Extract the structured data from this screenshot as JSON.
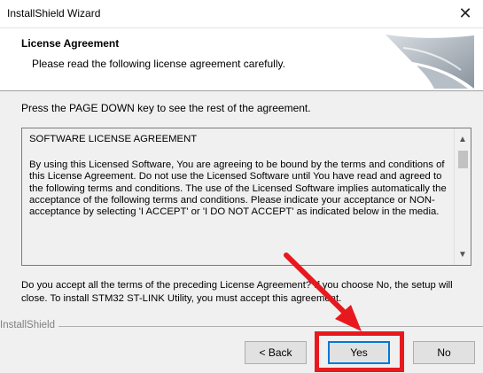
{
  "window": {
    "title": "InstallShield Wizard",
    "close_glyph": "✕"
  },
  "header": {
    "title": "License Agreement",
    "subtitle": "Please read the following license agreement carefully."
  },
  "instruction": "Press the PAGE DOWN key to see the rest of the agreement.",
  "license": {
    "heading": "SOFTWARE LICENSE AGREEMENT",
    "body": "By using this Licensed Software, You are agreeing to be bound by the terms and conditions of this License Agreement. Do not use the Licensed Software until You have read and agreed to the following terms and conditions. The use of the Licensed Software implies automatically the acceptance of the following terms and conditions. Please indicate your acceptance or NON-acceptance by selecting 'I ACCEPT' or 'I DO NOT ACCEPT' as indicated below in the media."
  },
  "question": "Do you accept all the terms of the preceding License Agreement? If you choose No, the setup will close. To install STM32 ST-LINK Utility, you must accept this agreement.",
  "group_label": "InstallShield",
  "buttons": {
    "back": "< Back",
    "yes": "Yes",
    "no": "No"
  },
  "annotation": {
    "highlight_color": "#e8191e",
    "arrow_color": "#e8191e"
  },
  "scrollbar": {
    "up_icon": "▲",
    "down_icon": "▼"
  }
}
